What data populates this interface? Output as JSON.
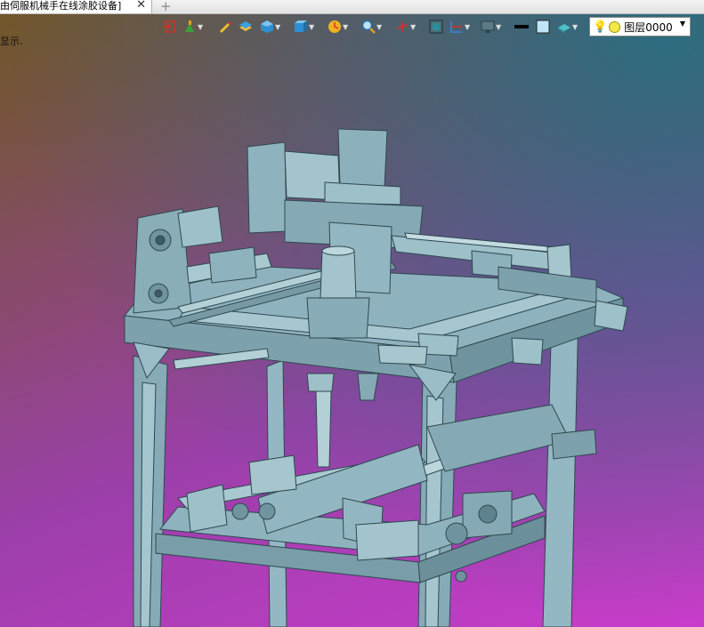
{
  "tab": {
    "title": "由伺服机械手在线涂胶设备]",
    "close_glyph": "✕",
    "add_glyph": "+"
  },
  "hint_text": "显示.",
  "toolbar": {
    "icons": [
      "exit-icon",
      "tree-icon",
      "pen-icon",
      "box-layers-icon",
      "cube-icon",
      "cube-views-icon",
      "clock-icon",
      "magnifier-icon",
      "axis-icon",
      "frame-icon",
      "section-icon",
      "display-icon",
      "line-color-swatch",
      "fill-color-swatch",
      "plane-icon"
    ],
    "layer": {
      "name": "图层0000"
    }
  },
  "colors": {
    "model": "#93b8c3",
    "model_dark": "#4d6c76",
    "accent_red": "#d0312d"
  }
}
